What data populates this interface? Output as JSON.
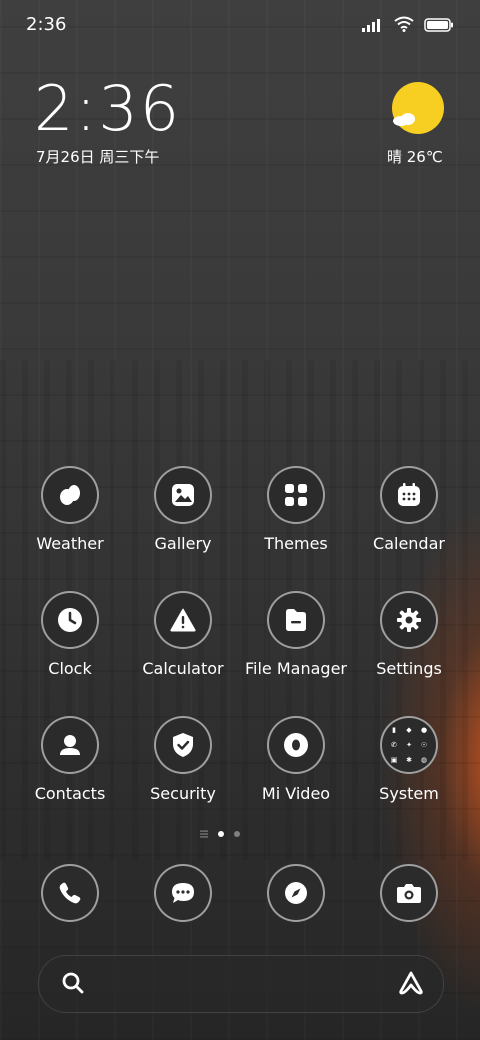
{
  "status_bar": {
    "time": "2:36",
    "icons": [
      "signal-icon",
      "wifi-icon",
      "battery-icon"
    ]
  },
  "clock_widget": {
    "time": "2:36",
    "date": "7月26日 周三下午"
  },
  "weather_widget": {
    "condition_temp": "晴 26℃",
    "icon": "sunny-cloud-icon",
    "sun_color": "#f7cf22"
  },
  "apps": [
    {
      "label": "Weather",
      "icon": "weather-icon"
    },
    {
      "label": "Gallery",
      "icon": "gallery-icon"
    },
    {
      "label": "Themes",
      "icon": "themes-icon"
    },
    {
      "label": "Calendar",
      "icon": "calendar-icon"
    },
    {
      "label": "Clock",
      "icon": "clock-icon"
    },
    {
      "label": "Calculator",
      "icon": "calculator-icon"
    },
    {
      "label": "File Manager",
      "icon": "file-manager-icon"
    },
    {
      "label": "Settings",
      "icon": "settings-icon"
    },
    {
      "label": "Contacts",
      "icon": "contacts-icon"
    },
    {
      "label": "Security",
      "icon": "security-icon"
    },
    {
      "label": "Mi Video",
      "icon": "mi-video-icon"
    },
    {
      "label": "System",
      "icon": "folder-icon"
    }
  ],
  "page_indicator": {
    "pages": 2,
    "active_page": 1
  },
  "dock": [
    {
      "icon": "phone-icon"
    },
    {
      "icon": "messages-icon"
    },
    {
      "icon": "browser-icon"
    },
    {
      "icon": "camera-icon"
    }
  ],
  "search": {
    "icon": "search-icon",
    "assistant_icon": "assistant-icon"
  }
}
